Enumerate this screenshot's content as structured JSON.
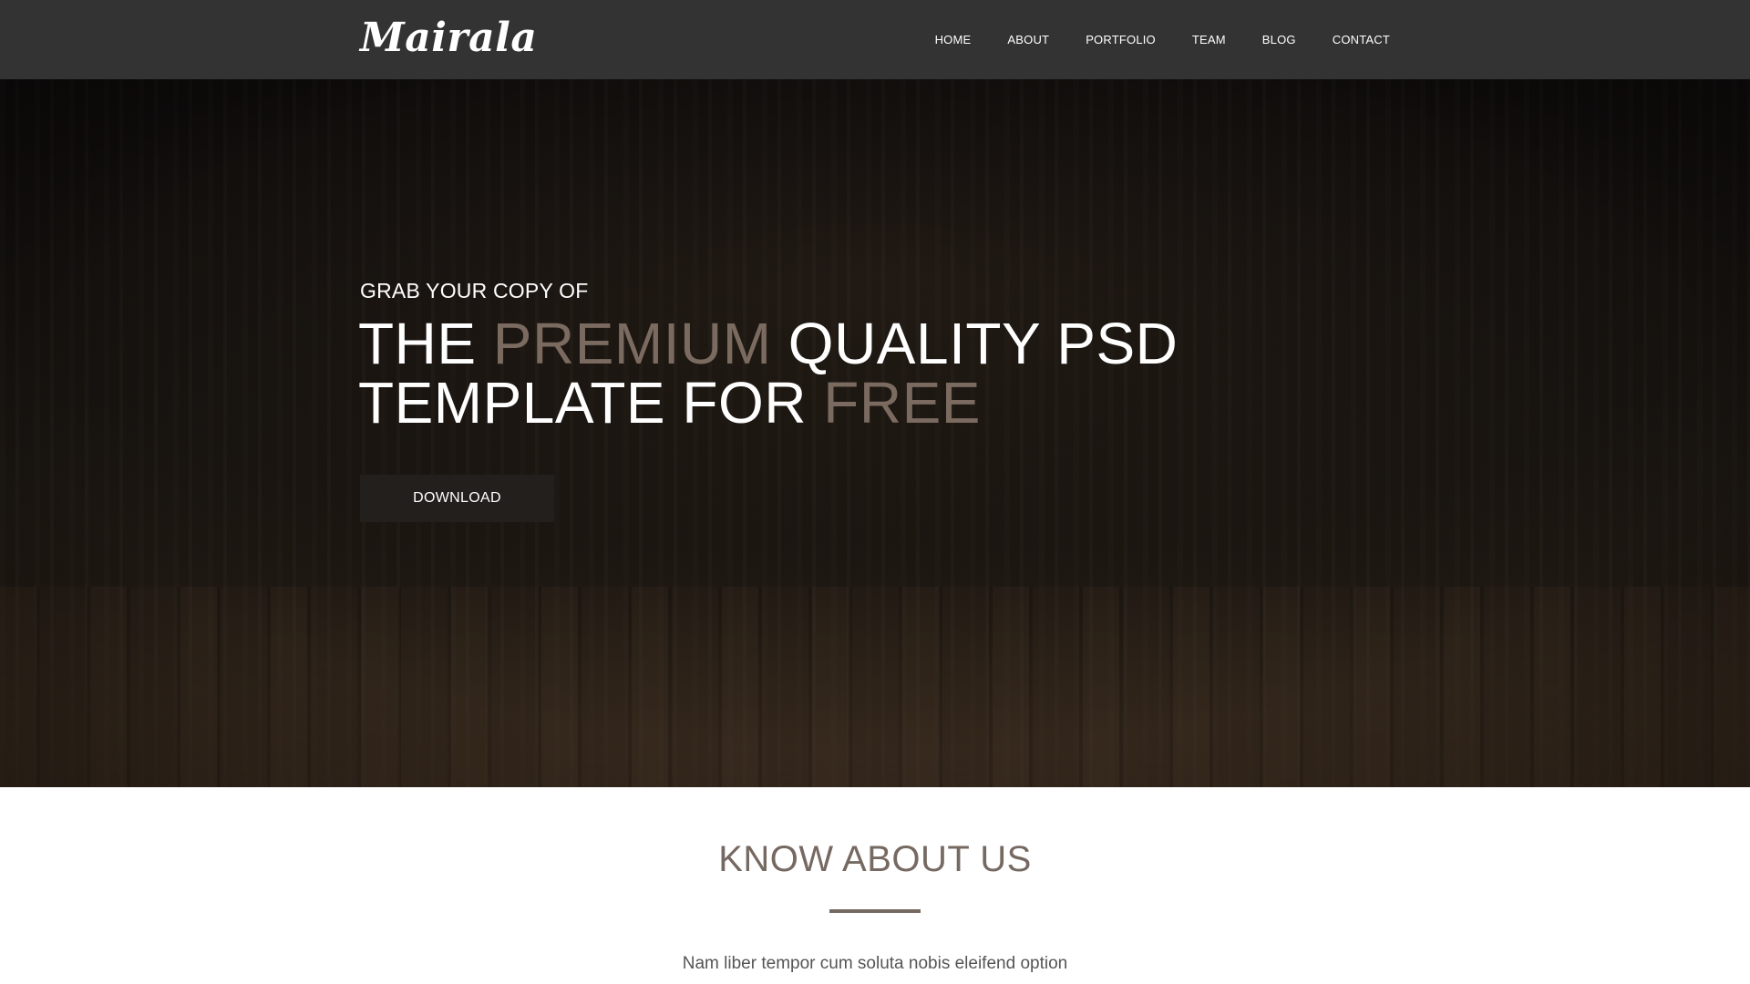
{
  "brand": {
    "logo_text": "Mairala"
  },
  "nav": {
    "items": [
      {
        "label": "HOME"
      },
      {
        "label": "ABOUT"
      },
      {
        "label": "PORTFOLIO"
      },
      {
        "label": "TEAM"
      },
      {
        "label": "BLOG"
      },
      {
        "label": "CONTACT"
      }
    ]
  },
  "hero": {
    "pretitle": "GRAB YOUR COPY OF",
    "title": {
      "part1": "THE ",
      "accent1": "PREMIUM",
      "part2": " QUALITY PSD",
      "part3": "TEMPLATE FOR ",
      "accent2": "FREE"
    },
    "download_label": "DOWNLOAD"
  },
  "about": {
    "title": "KNOW ABOUT US",
    "text": "Nam liber tempor cum soluta nobis eleifend option"
  },
  "colors": {
    "navbar_bg": "#333333",
    "accent": "#7a6a5f",
    "section_title": "#766962",
    "button_bg": "#231f1d"
  }
}
